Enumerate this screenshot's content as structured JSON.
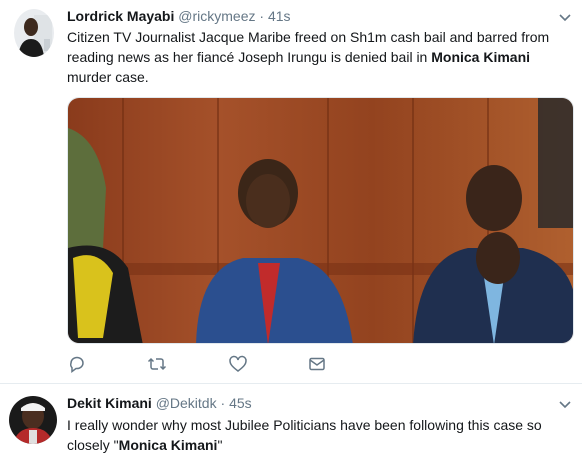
{
  "tweets": [
    {
      "name": "Lordrick Mayabi",
      "handle": "@rickymeez",
      "separator": "·",
      "time": "41s",
      "text_before": "Citizen TV Journalist Jacque Maribe freed on Sh1m cash bail and barred from reading news as her fiancé Joseph Irungu is denied bail in ",
      "text_bold": "Monica Kimani",
      "text_after": " murder case.",
      "actions": [
        "reply-icon",
        "retweet-icon",
        "like-icon",
        "direct-message-icon"
      ]
    },
    {
      "name": "Dekit Kimani",
      "handle": "@Dekitdk",
      "separator": "·",
      "time": "45s",
      "text_before": "I really wonder why most Jubilee Politicians have been following this case so closely \"",
      "text_bold": "Monica Kimani",
      "text_after": "\""
    }
  ],
  "colors": {
    "name": "#14171a",
    "secondary": "#657786",
    "divider": "#e6ecf0",
    "icon": "#657786"
  }
}
